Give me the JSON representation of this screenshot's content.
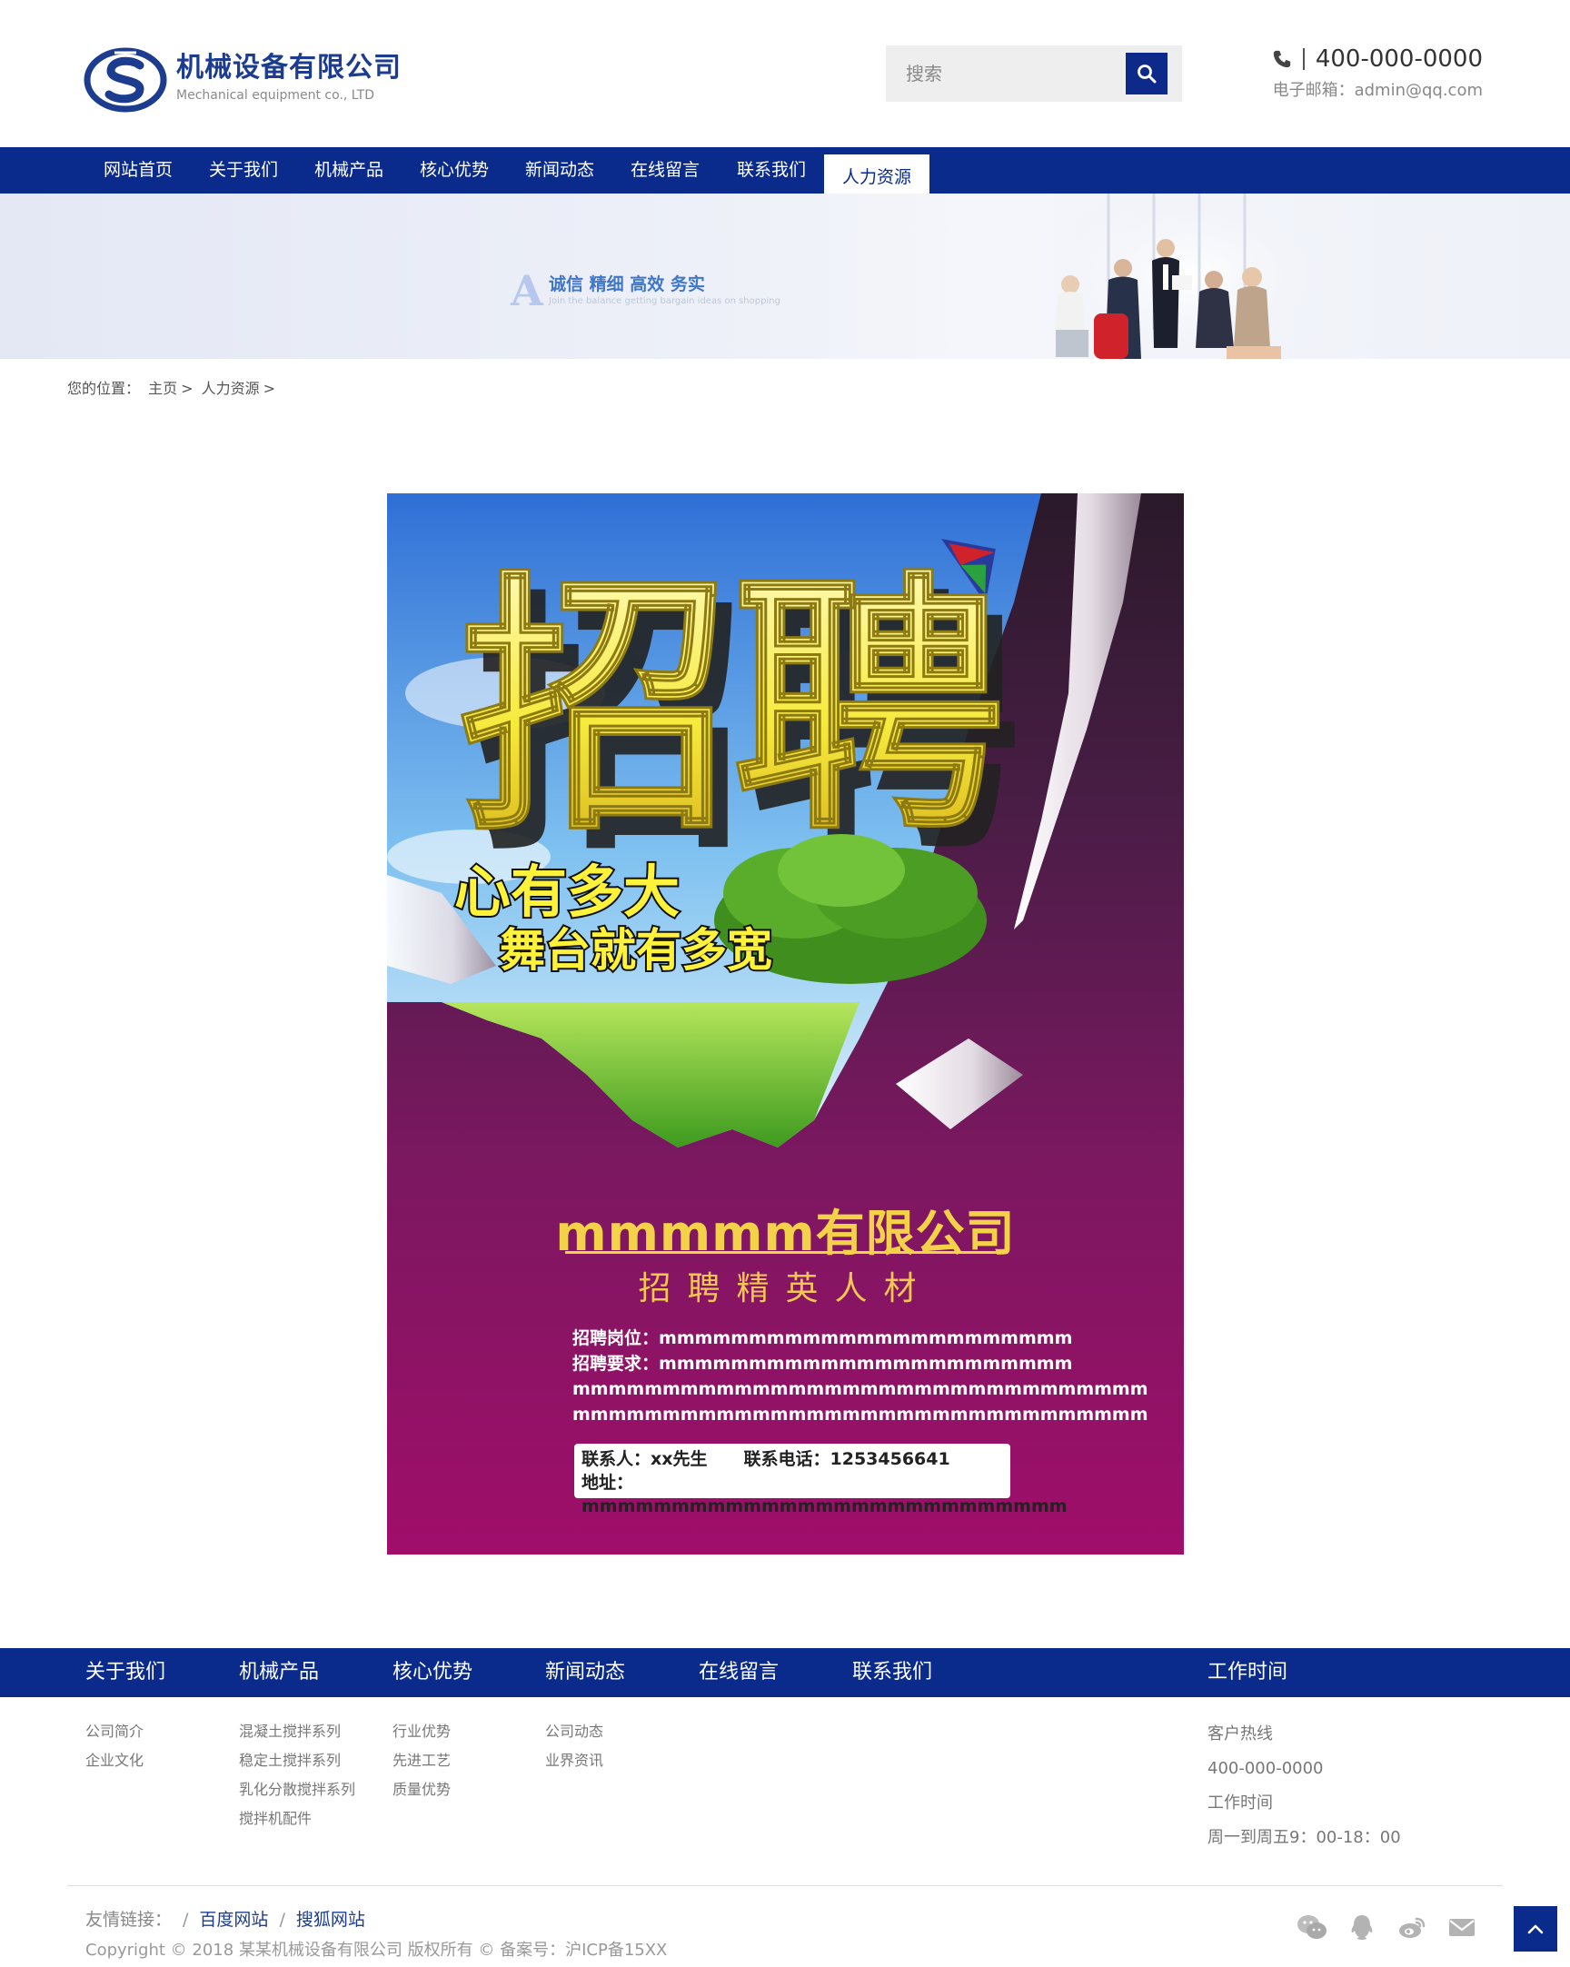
{
  "header": {
    "logo_cn": "机械设备有限公司",
    "logo_en": "Mechanical equipment co., LTD",
    "search_placeholder": "搜索",
    "phone": "400-000-0000",
    "email": "电子邮箱：admin@qq.com"
  },
  "nav": {
    "items": [
      "网站首页",
      "关于我们",
      "机械产品",
      "核心优势",
      "新闻动态",
      "在线留言",
      "联系我们",
      "人力资源"
    ],
    "active": "人力资源"
  },
  "banner": {
    "letter": "A",
    "slogan": "诚信 精细 高效 务实",
    "sub": "Join the balance getting bargain ideas on shopping"
  },
  "breadcrumb": {
    "label": "您的位置：",
    "home": "主页",
    "current": "人力资源"
  },
  "poster": {
    "headline": "招聘",
    "tagline_1": "心有多大",
    "tagline_2": "舞台就有多宽",
    "company": "mmmmm有限公司",
    "subtitle": "招聘精英人材",
    "position_label": "招聘岗位：",
    "position_value": "mmmmmmmmmmmmmmmmmmmmmmm",
    "requirement_label": "招聘要求：",
    "requirement_value": "mmmmmmmmmmmmmmmmmmmmmmm",
    "line_3": "mmmmmmmmmmmmmmmmmmmmmmmmmmmmmmmm",
    "line_4": "mmmmmmmmmmmmmmmmmmmmmmmmmmmmmmmm",
    "contact_label": "联系人：xx先生",
    "phone_label": "联系电话：1253456641",
    "address_label": "地址：",
    "address_value": "mmmmmmmmmmmmmmmmmmmmmmmmmmm"
  },
  "footer": {
    "nav": [
      "关于我们",
      "机械产品",
      "核心优势",
      "新闻动态",
      "在线留言",
      "联系我们",
      "工作时间"
    ],
    "col_about": [
      "公司简介",
      "企业文化"
    ],
    "col_products": [
      "混凝土搅拌系列",
      "稳定土搅拌系列",
      "乳化分散搅拌系列",
      "搅拌机配件"
    ],
    "col_advantages": [
      "行业优势",
      "先进工艺",
      "质量优势"
    ],
    "col_news": [
      "公司动态",
      "业界资讯"
    ],
    "work": [
      "客户热线",
      "400-000-0000",
      "工作时间",
      "周一到周五9：00-18：00"
    ],
    "links_label": "友情链接：",
    "links": [
      "百度网站",
      "搜狐网站"
    ],
    "copyright": "Copyright © 2018 某某机械设备有限公司 版权所有 © 备案号：沪ICP备15XX"
  },
  "colors": {
    "brand": "#0b2b8c",
    "poster_gold": "#f3d24a",
    "poster_bg": "#a00e6a"
  }
}
